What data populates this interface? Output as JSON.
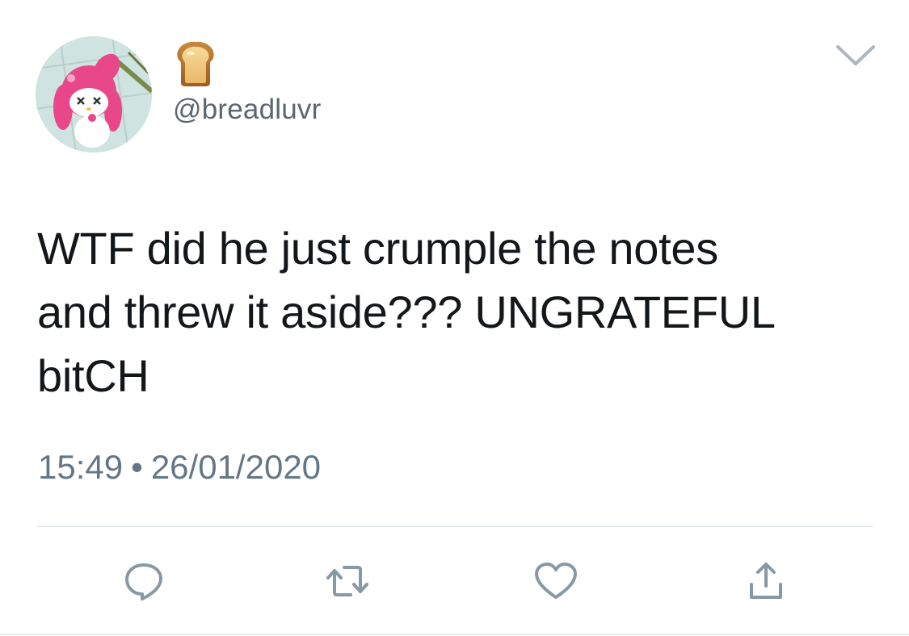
{
  "tweet": {
    "display_name_icon": "bread-emoji",
    "handle": "@breadluvr",
    "text": "WTF did he just crumple the notes\nand threw it aside??? UNGRATEFUL\nbitCH",
    "time": "15:49",
    "separator": "•",
    "date": "26/01/2020"
  },
  "actions": {
    "reply_icon": "reply-icon",
    "retweet_icon": "retweet-icon",
    "like_icon": "heart-icon",
    "share_icon": "share-icon"
  },
  "colors": {
    "text": "#14171a",
    "secondary": "#657786",
    "icon": "#8899a6",
    "divider": "#d7dde2",
    "avatar_pink": "#e8488a"
  }
}
